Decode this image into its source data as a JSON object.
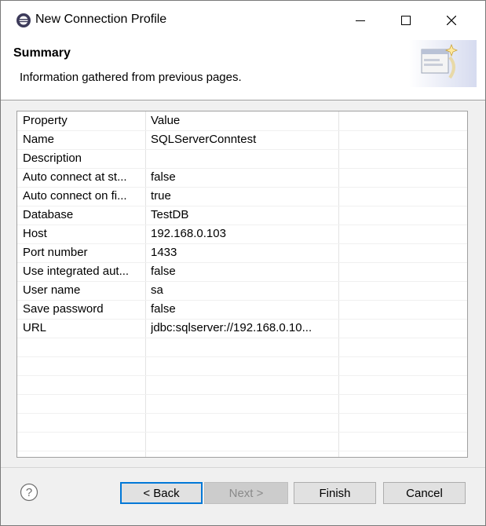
{
  "window": {
    "title": "New Connection Profile",
    "icons": {
      "app": "eclipse-icon",
      "minimize": "minimize-icon",
      "maximize": "maximize-icon",
      "close": "close-icon"
    }
  },
  "header": {
    "title": "Summary",
    "description": "Information gathered from previous pages.",
    "banner_icon": "wizard-banner-icon"
  },
  "table": {
    "columns": [
      "Property",
      "Value"
    ],
    "rows": [
      {
        "property": "Name",
        "value": "SQLServerConntest"
      },
      {
        "property": "Description",
        "value": ""
      },
      {
        "property": "Auto connect at st...",
        "value": "false"
      },
      {
        "property": "Auto connect on fi...",
        "value": "true"
      },
      {
        "property": "Database",
        "value": "TestDB"
      },
      {
        "property": "Host",
        "value": "192.168.0.103"
      },
      {
        "property": "Port number",
        "value": "1433"
      },
      {
        "property": "Use integrated aut...",
        "value": "false"
      },
      {
        "property": "User name",
        "value": "sa"
      },
      {
        "property": "Save password",
        "value": "false"
      },
      {
        "property": "URL",
        "value": "jdbc:sqlserver://192.168.0.10..."
      }
    ]
  },
  "footer": {
    "help_icon": "help-icon",
    "back_label": "< Back",
    "next_label": "Next >",
    "finish_label": "Finish",
    "cancel_label": "Cancel"
  },
  "colors": {
    "focus_border": "#0078d7",
    "button_bg": "#e1e1e1",
    "dialog_bg": "#f0f0f0"
  }
}
